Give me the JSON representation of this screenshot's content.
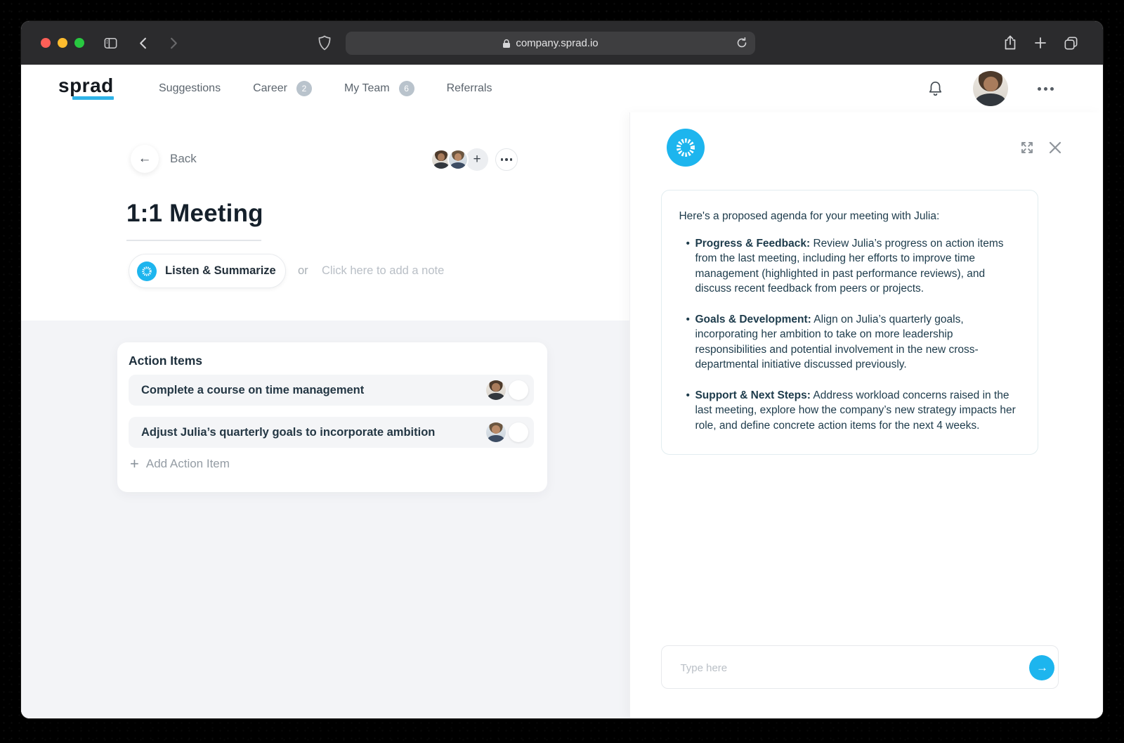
{
  "browser": {
    "url": "company.sprad.io",
    "traffic_lights": {
      "close": "#ff5f57",
      "minimize": "#febc2e",
      "zoom": "#28c840"
    }
  },
  "nav": {
    "logo": "sprad",
    "items": [
      {
        "label": "Suggestions"
      },
      {
        "label": "Career",
        "badge": "2"
      },
      {
        "label": "My Team",
        "badge": "6"
      },
      {
        "label": "Referrals"
      }
    ]
  },
  "header": {
    "back_label": "Back"
  },
  "meeting": {
    "title": "1:1 Meeting",
    "listen_button_label": "Listen & Summarize",
    "or_text": "or",
    "note_placeholder": "Click here to add a note"
  },
  "action_items": {
    "title": "Action Items",
    "rows": [
      {
        "text": "Complete a course on time management"
      },
      {
        "text": "Adjust Julia’s quarterly goals to incorporate ambition"
      }
    ],
    "add_label": "Add Action Item"
  },
  "assistant": {
    "intro": "Here's a proposed agenda for your meeting with Julia:",
    "bullets": [
      {
        "lead": "Progress & Feedback:",
        "text": "Review Julia’s progress on action items from the last meeting, including her efforts to improve time management (highlighted in past performance reviews), and discuss recent feedback from peers or projects."
      },
      {
        "lead": "Goals & Development:",
        "text": "Align on Julia’s quarterly goals, incorporating her ambition to take on more leadership responsibilities and potential involvement in the new cross-departmental initiative discussed previously."
      },
      {
        "lead": "Support & Next Steps:",
        "text": "Address workload concerns raised in the last meeting, explore how the company’s new strategy impacts her role, and define concrete action items for the next 4 weeks."
      }
    ],
    "input_placeholder": "Type here"
  },
  "glyphs": {
    "back_arrow": "←",
    "plus": "+",
    "send_arrow": "→"
  },
  "colors": {
    "accent": "#1db5ee",
    "badge": "#b9c3cc",
    "text_dark": "#1d3b4b"
  }
}
